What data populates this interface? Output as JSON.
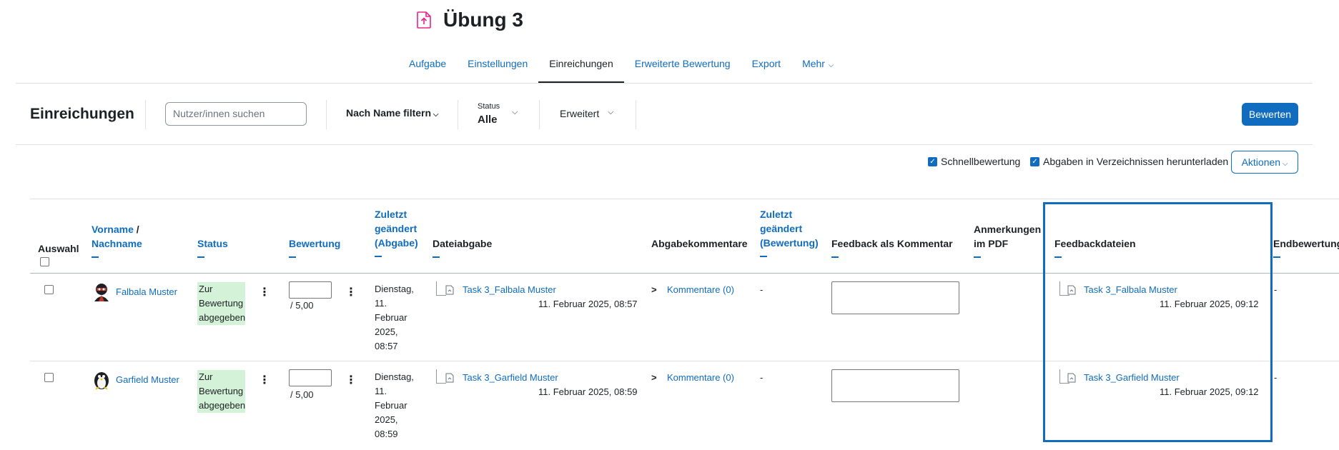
{
  "header": {
    "title": "Übung 3",
    "icon": "assignment-upload-icon"
  },
  "nav": {
    "tabs": [
      "Aufgabe",
      "Einstellungen",
      "Einreichungen",
      "Erweiterte Bewertung",
      "Export",
      "Mehr"
    ],
    "active": "Einreichungen"
  },
  "toolbar": {
    "title": "Einreichungen",
    "search_placeholder": "Nutzer/innen suchen",
    "name_filter": "Nach Name filtern",
    "status_label": "Status",
    "status_value": "Alle",
    "advanced": "Erweitert",
    "grade_button": "Bewerten"
  },
  "options": {
    "quick_grading": "Schnellbewertung",
    "download_folders": "Abgaben in Verzeichnissen herunterladen",
    "actions": "Aktionen"
  },
  "table": {
    "headers": {
      "select": "Auswahl",
      "firstname": "Vorname",
      "slash": " / ",
      "lastname": "Nachname",
      "status": "Status",
      "grade": "Bewertung",
      "modified_submission_1": "Zuletzt",
      "modified_submission_2": "geändert",
      "modified_submission_3": "(Abgabe)",
      "file_submission": "Dateiabgabe",
      "submission_comments": "Abgabekommentare",
      "modified_grade_1": "Zuletzt",
      "modified_grade_2": "geändert",
      "modified_grade_3": "(Bewertung)",
      "feedback_comment": "Feedback als Kommentar",
      "annotations_1": "Anmerkungen",
      "annotations_2": "im PDF",
      "feedback_files": "Feedbackdateien",
      "final_grade": "Endbewertung"
    },
    "rows": [
      {
        "name": "Falbala Muster",
        "status": [
          "Zur",
          "Bewertung",
          "abgegeben"
        ],
        "grade_max": "/ 5,00",
        "modified": [
          "Dienstag,",
          "11.",
          "Februar",
          "2025,",
          "08:57"
        ],
        "file_name": "Task 3_Falbala Muster",
        "file_date": "11. Februar 2025, 08:57",
        "comments": "Kommentare (0)",
        "grade_modified": "-",
        "feedback_file": "Task 3_Falbala Muster",
        "feedback_date": "11. Februar 2025, 09:12",
        "final": "-"
      },
      {
        "name": "Garfield Muster",
        "status": [
          "Zur",
          "Bewertung",
          "abgegeben"
        ],
        "grade_max": "/ 5,00",
        "modified": [
          "Dienstag,",
          "11.",
          "Februar",
          "2025,",
          "08:59"
        ],
        "file_name": "Task 3_Garfield Muster",
        "file_date": "11. Februar 2025, 08:59",
        "comments": "Kommentare (0)",
        "grade_modified": "-",
        "feedback_file": "Task 3_Garfield Muster",
        "feedback_date": "11. Februar 2025, 09:12",
        "final": "-"
      }
    ]
  },
  "colors": {
    "link": "#0f6cbf",
    "status_bg": "#d4f2d7",
    "highlight": "#0f6cbf",
    "title_icon": "#e8228b"
  }
}
